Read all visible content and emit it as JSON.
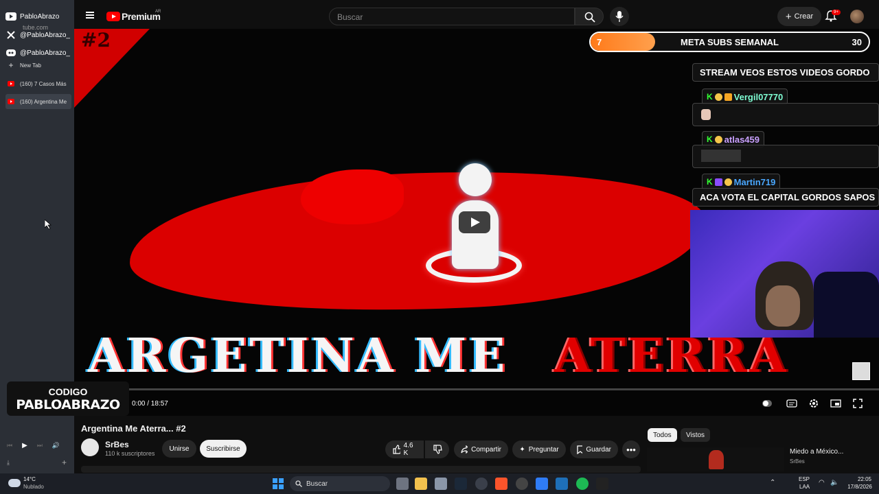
{
  "sidebar": {
    "items": [
      {
        "label": "PabloAbrazo",
        "sublabel": "tube.com",
        "icon": "youtube-icon"
      },
      {
        "label": "@PabloAbrazo_",
        "icon": "x-twitter-icon"
      },
      {
        "label": "@PabloAbrazo_",
        "icon": "discord-icon"
      },
      {
        "label": "New Tab",
        "icon": "plus-icon"
      },
      {
        "label": "(160) 7 Casos Más",
        "icon": "youtube-icon"
      },
      {
        "label": "(160) Argentina Me",
        "icon": "youtube-icon"
      }
    ]
  },
  "header": {
    "brand": "Premium",
    "region": "AR",
    "search_placeholder": "Buscar",
    "create_label": "Crear",
    "notifications_badge": "9+"
  },
  "video": {
    "overlay_title_white": "ARGETINA ME",
    "overlay_title_red": "ATERRA",
    "corner_text": "#2",
    "time": "0:00 / 18:57",
    "progress": 0
  },
  "overlays": {
    "meta": {
      "current": "7",
      "label": "META SUBS SEMANAL",
      "goal": "30",
      "fill_fraction": 0.233
    },
    "chat": {
      "message_top": "STREAM VEOS ESTOS VIDEOS GORDO",
      "users": [
        {
          "badge": "K",
          "name": "Vergil07770",
          "color": "#7fffd4"
        },
        {
          "badge": "K",
          "name": "atlas459",
          "color": "#c9a0ff"
        },
        {
          "badge": "K",
          "name": "Martin719",
          "color": "#4aa8ff"
        }
      ],
      "message_bottom": "ACA VOTA EL CAPITAL GORDOS SAPOS"
    },
    "codigo_label": "CODIGO",
    "codigo_value": "PABLOABRAZO"
  },
  "below": {
    "title": "Argentina Me Aterra... #2",
    "channel": "SrBes",
    "subs": "110 k suscriptores",
    "join": "Unirse",
    "subscribe": "Suscribirse",
    "likes": "4.6 K",
    "share": "Compartir",
    "ask": "Preguntar",
    "save": "Guardar",
    "chips": [
      "Todos",
      "Vistos"
    ],
    "rec_title": "Miedo a México...",
    "rec_channel": "SrBes"
  },
  "taskbar": {
    "weather_temp": "14°C",
    "weather_desc": "Nublado",
    "search": "Buscar",
    "lang": "ESP",
    "layout": "LAA",
    "time": "22:05",
    "date": "17/8/2026"
  }
}
